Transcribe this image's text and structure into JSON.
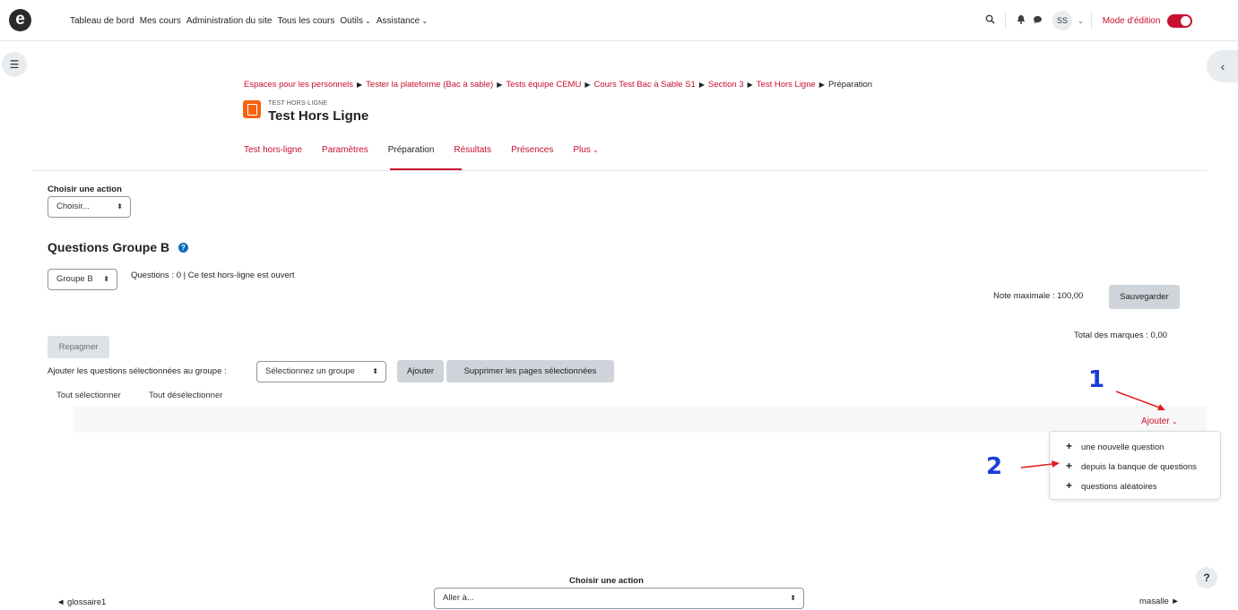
{
  "header": {
    "logo_letter": "e",
    "nav": [
      "Tableau de bord",
      "Mes cours",
      "Administration du site",
      "Tous les cours"
    ],
    "nav_dropdowns": [
      "Outils",
      "Assistance"
    ],
    "user_initials": "SS",
    "edit_mode_label": "Mode d'édition",
    "edit_mode_on": true,
    "icons": [
      "search-icon",
      "bell-icon",
      "chat-icon"
    ]
  },
  "breadcrumb": {
    "links": [
      "Espaces pour les personnels",
      "Tester la plateforme (Bac à sable)",
      "Tests équipe CEMU",
      "Cours Test Bac à Sable S1",
      "Section 3",
      "Test Hors Ligne"
    ],
    "current": "Préparation",
    "separator": "▶"
  },
  "module": {
    "type": "TEST HORS-LIGNE",
    "title": "Test Hors Ligne",
    "icon_color": "#f7630c"
  },
  "tabs": [
    {
      "label": "Test hors-ligne",
      "active": false
    },
    {
      "label": "Paramètres",
      "active": false
    },
    {
      "label": "Préparation",
      "active": true
    },
    {
      "label": "Résultats",
      "active": false
    },
    {
      "label": "Présences",
      "active": false
    },
    {
      "label": "Plus",
      "active": false
    }
  ],
  "action_top": {
    "label": "Choisir une action",
    "select_value": "Choisir..."
  },
  "section": {
    "title": "Questions Groupe B",
    "group_select": "Groupe B",
    "info": "Questions : 0 | Ce test hors-ligne est ouvert",
    "max_grade_label": "Note maximale : 100,00",
    "save_button": "Sauvegarder",
    "total_marks": "Total des marques : 0,00",
    "repaginate_button": "Repaginer",
    "add_to_group_label": "Ajouter les questions sélectionnées au groupe :",
    "group_placeholder": "Sélectionnez un groupe",
    "add_button": "Ajouter",
    "delete_pages_button": "Supprimer les pages sélectionnées",
    "select_all": "Tout sélectionner",
    "deselect_all": "Tout désélectionner"
  },
  "add_menu": {
    "trigger": "Ajouter",
    "items": [
      "une nouvelle question",
      "depuis la banque de questions",
      "questions aléatoires"
    ]
  },
  "annotations": [
    "1",
    "2"
  ],
  "footer": {
    "action_label": "Choisir une action",
    "jump_placeholder": "Aller à...",
    "prev": "◄ glossaire1",
    "next": "masalle ►",
    "help": "?"
  },
  "colors": {
    "accent": "#c8102e",
    "annotation_blue": "#1a3fd6",
    "annotation_arrow": "#e02020"
  }
}
